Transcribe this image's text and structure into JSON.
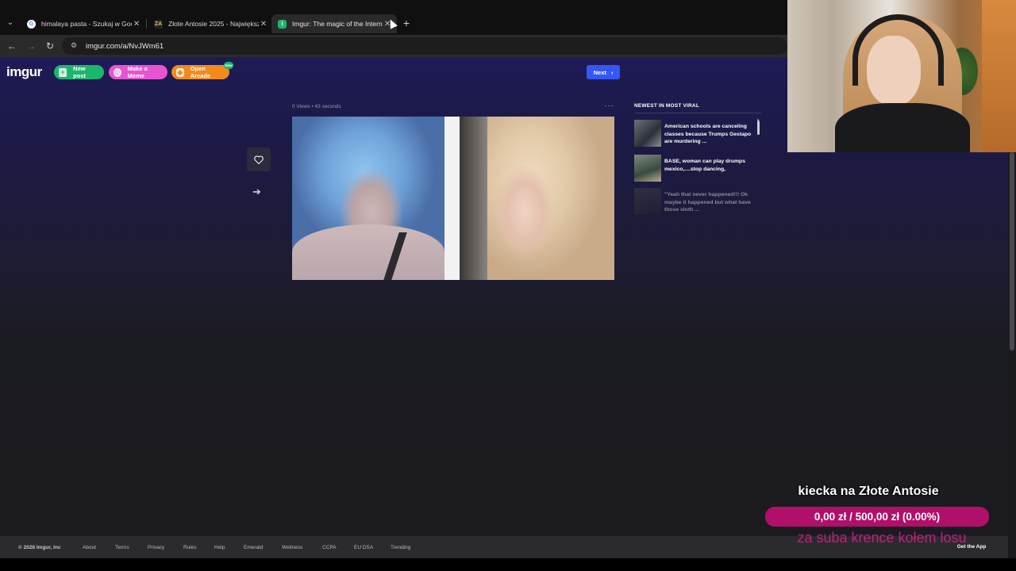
{
  "browser": {
    "tabs": [
      {
        "title": "himalaya pasta - Szukaj w Goog",
        "favicon": "google-icon",
        "active": false
      },
      {
        "title": "Złote Antosie 2025 - Największ",
        "favicon": "za-icon",
        "active": false
      },
      {
        "title": "Imgur: The magic of the Intern",
        "favicon": "imgur-icon",
        "active": true
      }
    ],
    "url": "imgur.com/a/NvJWm61"
  },
  "header": {
    "logo": "imgur",
    "new_post": "New post",
    "make_meme": "Make a Meme",
    "open_arcade": "Open Arcade",
    "new_badge": "New",
    "next": "Next"
  },
  "post": {
    "meta": "0 Views • 43 seconds",
    "more": "···"
  },
  "sidebar": {
    "heading": "NEWEST IN MOST VIRAL",
    "items": [
      {
        "title": "American schools are canceling classes because Trumps Gestapo are murdering ..."
      },
      {
        "title": "BASE,  woman can play drumps mexico,....stop dancing,"
      },
      {
        "title": "\"Yeah that never happened!!! Ok maybe it happened but what have those sloth ..."
      }
    ]
  },
  "footer": {
    "copyright": "© 2026 Imgur, Inc",
    "links": [
      "About",
      "Terms",
      "Privacy",
      "Rules",
      "Help",
      "Emerald",
      "Wellness",
      "CCPA",
      "EU DSA",
      "Trending"
    ],
    "get_app": "Get the App"
  },
  "overlay": {
    "goal_title": "kiecka na Złote Antosie",
    "goal_progress_text": "0,00 zł  /  500,00 zł (0.00%)",
    "goal_progress_fraction": 0.0,
    "goal_subtext": "za suba krence kołem losu"
  },
  "colors": {
    "accent_blue": "#3557f7",
    "green": "#1bb76e",
    "pink": "#e754d1",
    "orange": "#f28a1c",
    "goal_magenta": "#e0148a"
  }
}
